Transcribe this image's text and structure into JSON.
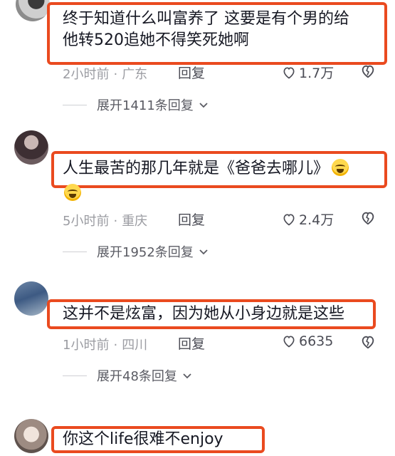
{
  "comments": [
    {
      "text_line1": "终于知道什么叫富养了  这要是有个男的给",
      "text_line2": "他转520追她不得笑死她啊",
      "time": "2小时前",
      "location": "广东",
      "reply_label": "回复",
      "likes": "1.7万",
      "expand_label": "展开1411条回复"
    },
    {
      "text_line1": "人生最苦的那几年就是《爸爸去哪儿》",
      "emoji": "crying-laughing-emoji",
      "time": "5小时前",
      "location": "重庆",
      "reply_label": "回复",
      "likes": "2.4万",
      "expand_label": "展开1952条回复"
    },
    {
      "text_line1": "这并不是炫富，因为她从小身边就是这些",
      "time": "1小时前",
      "location": "四川",
      "reply_label": "回复",
      "likes": "6635",
      "expand_label": "展开48条回复"
    },
    {
      "text_line1": "你这个life很难不enjoy"
    }
  ],
  "separator": "·",
  "colors": {
    "highlight_border": "#ea4a1f",
    "meta_text": "#9b9ca2",
    "primary_text": "#161823"
  }
}
